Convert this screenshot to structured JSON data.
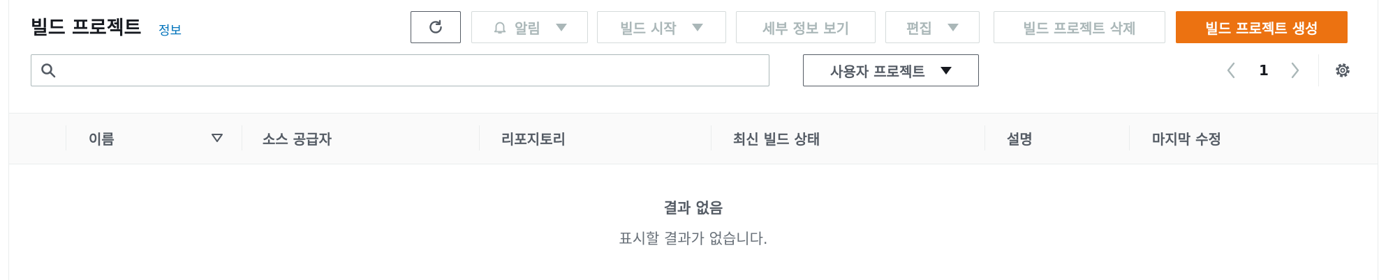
{
  "header": {
    "title": "빌드 프로젝트",
    "info_link": "정보"
  },
  "toolbar": {
    "alerts_label": "알림",
    "start_build_label": "빌드 시작",
    "view_details_label": "세부 정보 보기",
    "edit_label": "편집",
    "delete_label": "빌드 프로젝트 삭제",
    "create_label": "빌드 프로젝트 생성"
  },
  "search": {
    "value": "",
    "placeholder": ""
  },
  "filter": {
    "selected": "사용자 프로젝트"
  },
  "pagination": {
    "current_page": "1"
  },
  "table": {
    "columns": [
      "이름",
      "소스 공급자",
      "리포지토리",
      "최신 빌드 상태",
      "설명",
      "마지막 수정"
    ]
  },
  "empty_state": {
    "title": "결과 없음",
    "description": "표시할 결과가 없습니다."
  },
  "colors": {
    "primary": "#ec7211",
    "link": "#0073bb",
    "text": "#16191f",
    "muted": "#aab7b8"
  },
  "icons": {
    "refresh": "refresh-icon",
    "alerts": "bell-icon",
    "search": "search-icon",
    "settings": "gear-icon",
    "sort": "sort-down-icon"
  }
}
